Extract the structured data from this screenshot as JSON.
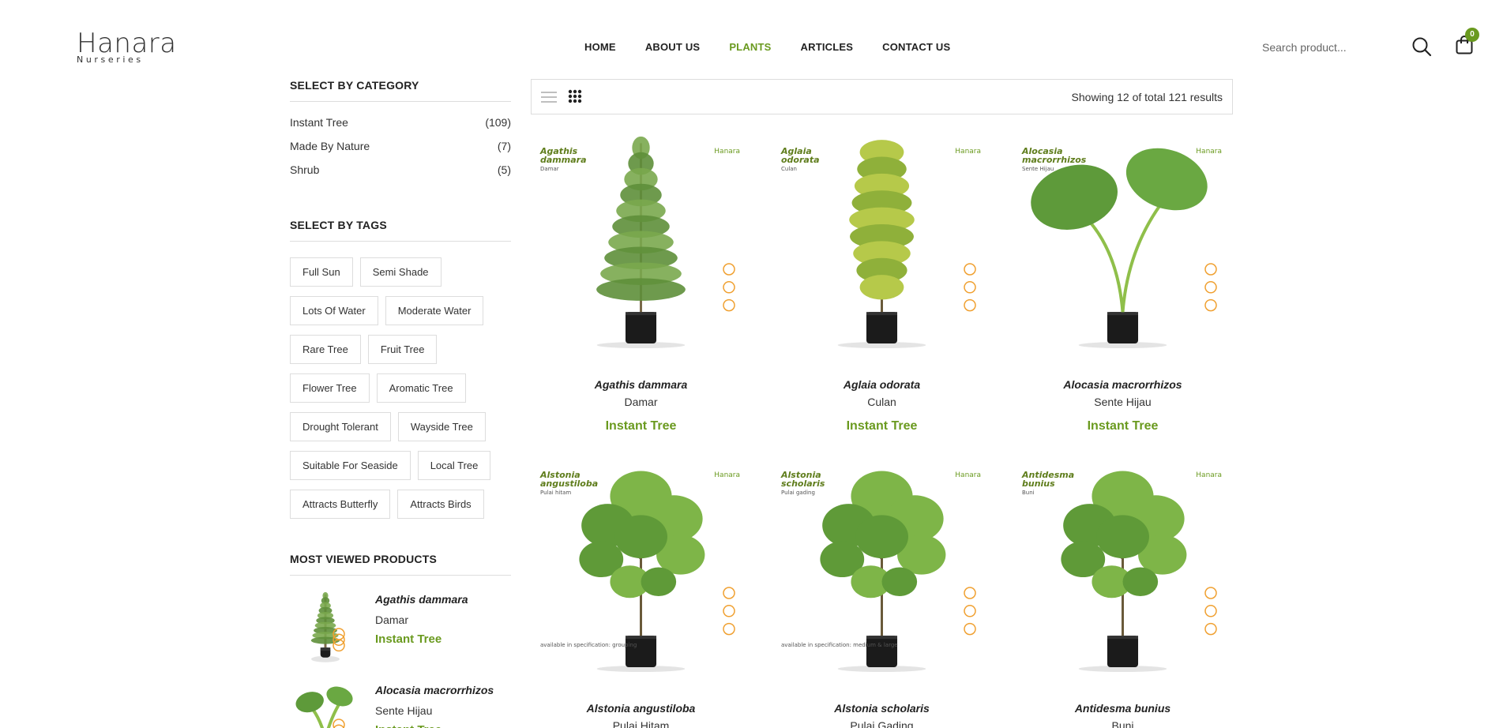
{
  "header": {
    "logo_main": "Hanara",
    "logo_sub": "Nurseries",
    "nav": [
      {
        "label": "HOME",
        "active": false
      },
      {
        "label": "ABOUT US",
        "active": false
      },
      {
        "label": "PLANTS",
        "active": true
      },
      {
        "label": "ARTICLES",
        "active": false
      },
      {
        "label": "CONTACT US",
        "active": false
      }
    ],
    "search_placeholder": "Search product...",
    "cart_count": "0"
  },
  "sidebar": {
    "category_title": "SELECT BY CATEGORY",
    "categories": [
      {
        "name": "Instant Tree",
        "count": "(109)"
      },
      {
        "name": "Made By Nature",
        "count": "(7)"
      },
      {
        "name": "Shrub",
        "count": "(5)"
      }
    ],
    "tags_title": "SELECT BY TAGS",
    "tags": [
      "Full Sun",
      "Semi Shade",
      "Lots Of Water",
      "Moderate Water",
      "Rare Tree",
      "Fruit Tree",
      "Flower Tree",
      "Aromatic Tree",
      "Drought Tolerant",
      "Wayside Tree",
      "Suitable For Seaside",
      "Local Tree",
      "Attracts Butterfly",
      "Attracts Birds"
    ],
    "most_viewed_title": "MOST VIEWED PRODUCTS",
    "most_viewed": [
      {
        "scientific": "Agathis dammara",
        "common": "Damar",
        "category": "Instant Tree"
      },
      {
        "scientific": "Alocasia macrorrhizos",
        "common": "Sente Hijau",
        "category": "Instant Tree"
      }
    ]
  },
  "toolbar": {
    "results_text": "Showing 12 of total 121 results"
  },
  "products": [
    {
      "scientific": "Agathis dammara",
      "label_sci": "Agathis dammara",
      "common": "Damar",
      "label_com": "Damar",
      "category": "Instant Tree",
      "brand": "Hanara",
      "avail": "",
      "type": "conifer"
    },
    {
      "scientific": "Aglaia odorata",
      "label_sci": "Aglaia odorata",
      "common": "Culan",
      "label_com": "Culan",
      "category": "Instant Tree",
      "brand": "Hanara",
      "avail": "",
      "type": "bush"
    },
    {
      "scientific": "Alocasia macrorrhizos",
      "label_sci": "Alocasia macrorrhizos",
      "common": "Sente Hijau",
      "label_com": "Sente Hijau",
      "category": "Instant Tree",
      "brand": "Hanara",
      "avail": "",
      "type": "leaf"
    },
    {
      "scientific": "Alstonia angustiloba",
      "label_sci": "Alstonia angustiloba",
      "common": "Pulai Hitam",
      "label_com": "Pulai hitam",
      "category": "",
      "brand": "Hanara",
      "avail": "available in specification: grouping",
      "type": "tree"
    },
    {
      "scientific": "Alstonia scholaris",
      "label_sci": "Alstonia scholaris",
      "common": "Pulai Gading",
      "label_com": "Pulai gading",
      "category": "",
      "brand": "Hanara",
      "avail": "available in specification: medium & large",
      "type": "tree"
    },
    {
      "scientific": "Antidesma bunius",
      "label_sci": "Antidesma bunius",
      "common": "Buni",
      "label_com": "Buni",
      "category": "",
      "brand": "Hanara",
      "avail": "",
      "type": "tree"
    }
  ],
  "colors": {
    "accent": "#6a9a1f",
    "text": "#222222",
    "border": "#dddddd",
    "icon_orange": "#f0a030"
  }
}
